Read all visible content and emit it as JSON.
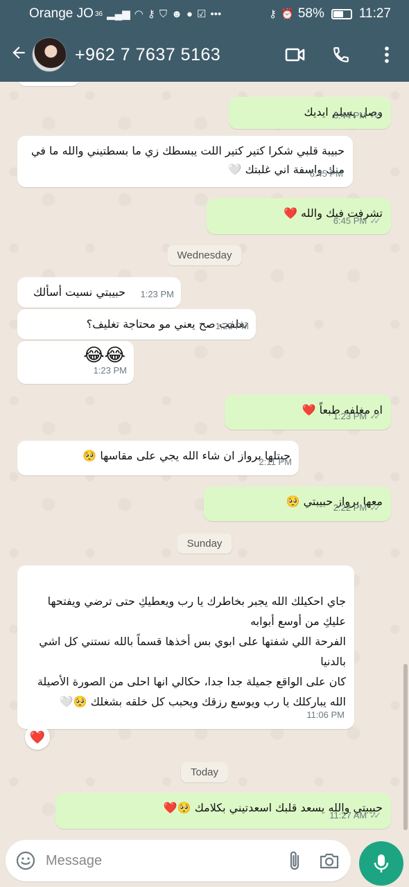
{
  "status_bar": {
    "carrier": "Orange JO",
    "network": "36",
    "battery": "58%",
    "battery_level": 0.58,
    "time": "11:27"
  },
  "header": {
    "contact_name": "+962 7 7637 5163",
    "icons": [
      "back-arrow-icon",
      "video-call-icon",
      "voice-call-icon",
      "more-options-icon"
    ]
  },
  "messages": [
    {
      "dir": "out",
      "text": "وصل يسلم ايديك",
      "time": "6:44 PM"
    },
    {
      "dir": "in",
      "text": "حبيبة قلبي شكرا كتير كتير اللت يبسطك زي ما بسطتيني والله ما في منك واسفة اني غلبتك 🤍",
      "time": "6:45 PM"
    },
    {
      "dir": "out",
      "text": "تشرفت فيك والله ❤️",
      "time": "6:45 PM"
    },
    {
      "dir": "in",
      "text": "حبيبتي نسيت أسألك",
      "time": "1:23 PM"
    },
    {
      "dir": "in",
      "text": "تغلفت صح يعني مو محتاجة تغليف؟",
      "time": "1:23 PM"
    },
    {
      "dir": "in",
      "text": "😂😂",
      "time": "1:23 PM"
    },
    {
      "dir": "out",
      "text": "اه مغلفه طبعاً ❤️",
      "time": "1:23 PM"
    },
    {
      "dir": "in",
      "text": "جبتلها برواز ان شاء الله يجي على مقاسها 🥺",
      "time": "2:11 PM"
    },
    {
      "dir": "out",
      "text": "معها برواز حبيبتي 🥺",
      "time": "2:22 PM"
    },
    {
      "dir": "in",
      "text": "جاي احكيلك الله يجبر بخاطرك يا رب ويعطيكِ حتى ترضي ويفتحها عليكِ من أوسع أبوابه\nالفرحة اللي شفتها على ابوي بس أخذها قسماً بالله نستني كل اشي بالدنيا\nكان على الواقع جميلة جدا جدا، حكالي انها احلى من الصورة الأصيلة\nالله يباركلك يا رب ويوسع رزقك ويحبب كل خلقه بشغلك 🥺🤍",
      "time": "11:06 PM"
    },
    {
      "dir": "out",
      "text": "حبيبتي والله يسعد قلبك اسعدتيني بكلامك 🥺❤️",
      "time": "11:27 AM"
    }
  ],
  "day_labels": [
    "Wednesday",
    "Sunday",
    "Today"
  ],
  "reaction": "❤️",
  "composer": {
    "placeholder": "Message"
  },
  "colors": {
    "header": "#3f5c6b",
    "outgoing_bubble": "#dcf8c6",
    "incoming_bubble": "#ffffff",
    "background": "#efe7de",
    "mic_button": "#1da583"
  }
}
